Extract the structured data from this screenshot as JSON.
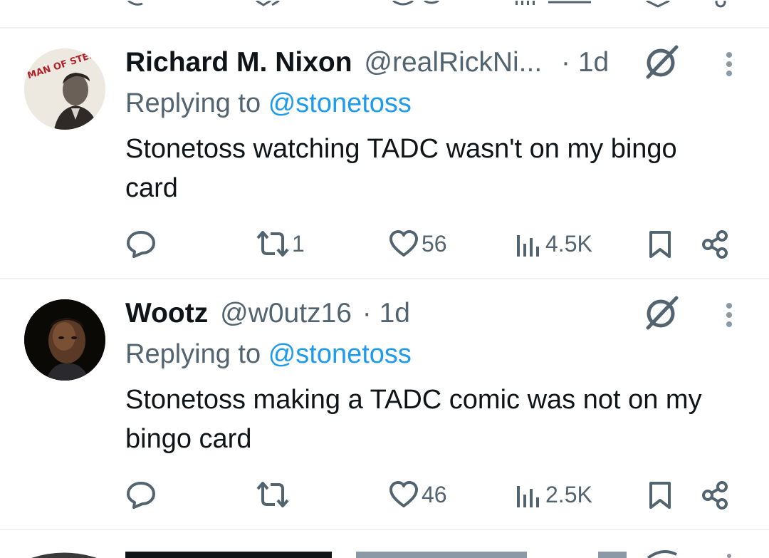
{
  "tweets": [
    {
      "display_name": "Richard M. Nixon",
      "handle": "@realRickNi...",
      "time": "· 1d",
      "reply_prefix": "Replying to",
      "reply_to": "@stonetoss",
      "text": "Stonetoss watching TADC wasn't on my bingo card",
      "retweets": "1",
      "likes": "56",
      "views": "4.5K",
      "avatar_badge_text": "MAN OF STEEL"
    },
    {
      "display_name": "Wootz",
      "handle": "@w0utz16",
      "time": "· 1d",
      "reply_prefix": "Replying to",
      "reply_to": "@stonetoss",
      "text": "Stonetoss making a TADC comic was not on my bingo card",
      "retweets": "",
      "likes": "46",
      "views": "2.5K"
    }
  ],
  "icons": {
    "reply": "reply-icon",
    "retweet": "retweet-icon",
    "like": "heart-icon",
    "views": "views-icon",
    "bookmark": "bookmark-icon",
    "share": "share-icon",
    "grok": "grok-icon",
    "more": "more-icon"
  },
  "colors": {
    "text": "#0f1419",
    "muted": "#536471",
    "link": "#1d9bf0",
    "divider": "#eff3f4"
  }
}
